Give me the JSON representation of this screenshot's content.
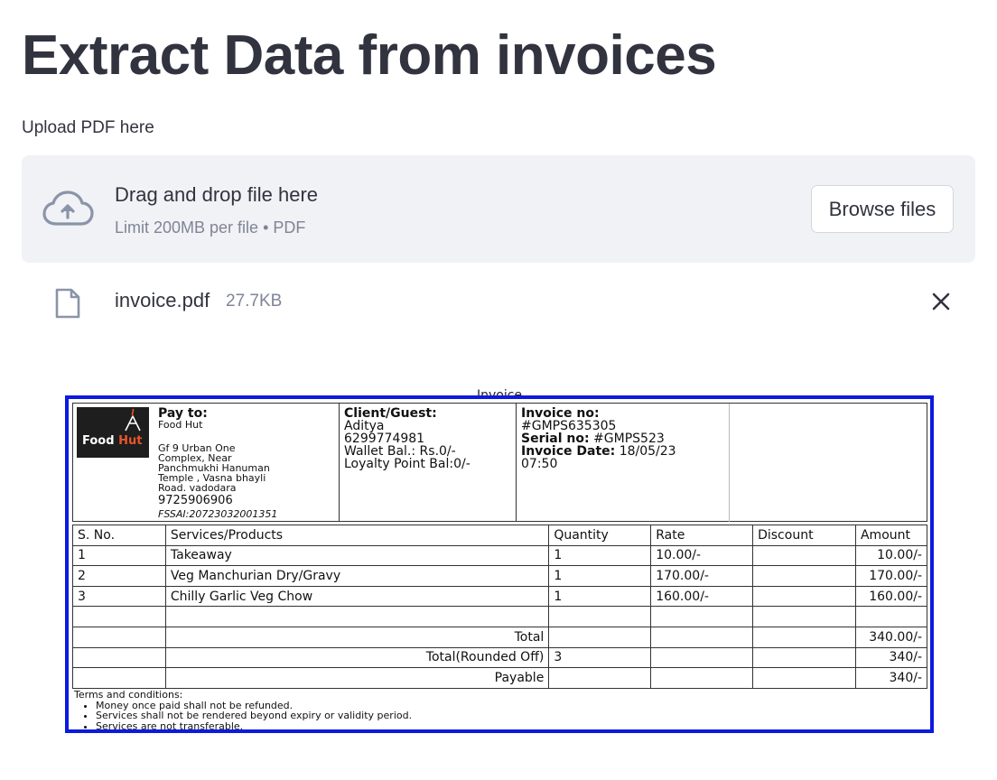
{
  "page": {
    "title": "Extract Data from invoices",
    "upload_label": "Upload PDF here"
  },
  "dropzone": {
    "title": "Drag and drop file here",
    "limit": "Limit 200MB per file • PDF",
    "browse_label": "Browse files"
  },
  "uploaded_file": {
    "name": "invoice.pdf",
    "size": "27.7KB"
  },
  "invoice": {
    "caption": "Invoice",
    "logo": {
      "food": "Food",
      "hut": "Hut"
    },
    "pay_to": {
      "heading": "Pay to:",
      "name": "Food Hut",
      "address": [
        "Gf 9 Urban One",
        "Complex, Near",
        "Panchmukhi Hanuman",
        "Temple , Vasna bhayli",
        "Road. vadodara"
      ],
      "phone": "9725906906",
      "fssai": "FSSAI:20723032001351"
    },
    "client": {
      "heading": "Client/Guest:",
      "name": "Aditya",
      "phone": "6299774981",
      "wallet": "Wallet Bal.: Rs.0/-",
      "loyalty": "Loyalty Point Bal:0/-"
    },
    "meta": {
      "invoice_no_label": "Invoice no:",
      "invoice_no": "#GMPS635305",
      "serial_label": "Serial no:",
      "serial_no": "#GMPS523",
      "date_label": "Invoice Date:",
      "date": "18/05/23",
      "time": "07:50"
    },
    "columns": [
      "S. No.",
      "Services/Products",
      "Quantity",
      "Rate",
      "Discount",
      "Amount"
    ],
    "rows": [
      {
        "sno": "1",
        "item": "Takeaway",
        "qty": "1",
        "rate": "10.00/-",
        "discount": "",
        "amount": "10.00/-"
      },
      {
        "sno": "2",
        "item": "Veg Manchurian Dry/Gravy",
        "qty": "1",
        "rate": "170.00/-",
        "discount": "",
        "amount": "170.00/-"
      },
      {
        "sno": "3",
        "item": "Chilly Garlic Veg Chow",
        "qty": "1",
        "rate": "160.00/-",
        "discount": "",
        "amount": "160.00/-"
      }
    ],
    "totals": {
      "total_label": "Total",
      "total_amount": "340.00/-",
      "rounded_label": "Total(Rounded Off)",
      "rounded_qty": "3",
      "rounded_amount": "340/-",
      "payable_label": "Payable",
      "payable_amount": "340/-"
    },
    "terms": {
      "heading": "Terms and conditions:",
      "items": [
        "Money once paid shall not be refunded.",
        "Services shall not be rendered beyond expiry or validity period.",
        "Services are not transferable."
      ]
    }
  },
  "colors": {
    "text": "#31333f",
    "muted": "#808495",
    "dropzone_bg": "#f0f2f6",
    "invoice_border": "#0c1adf",
    "logo_accent": "#e8552a"
  },
  "icons": {
    "upload": "cloud-upload-icon",
    "file": "file-icon",
    "close": "close-icon"
  }
}
